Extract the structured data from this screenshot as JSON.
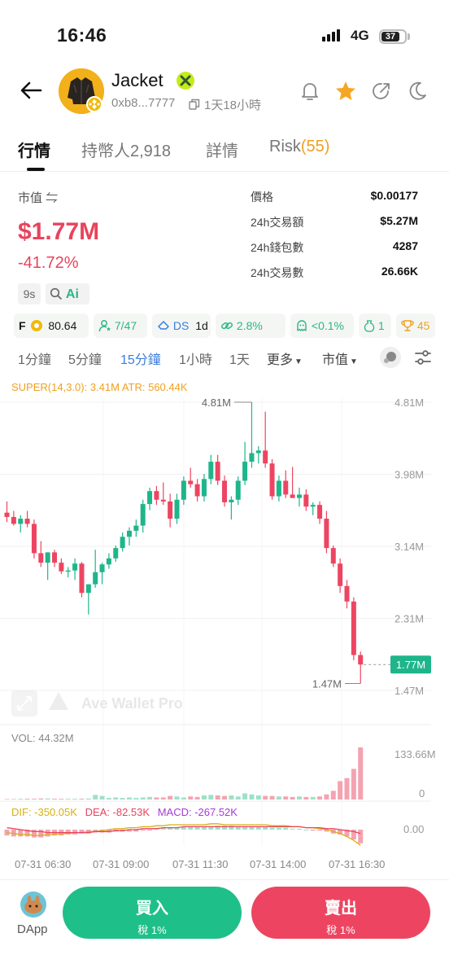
{
  "status_bar": {
    "time": "16:46",
    "network": "4G",
    "battery": "37"
  },
  "header": {
    "token_name": "Jacket",
    "address": "0xb8...7777",
    "age": "1天18小時"
  },
  "tabs": [
    {
      "label": "行情"
    },
    {
      "label": "持幣人2,918"
    },
    {
      "label": "詳情"
    },
    {
      "label": "Risk",
      "count": "(55)"
    }
  ],
  "summary": {
    "market_cap_label": "市值 ⇋",
    "market_cap": "$1.77M",
    "change": "-41.72%",
    "refresh": "9s",
    "ai_label": "Ai"
  },
  "stats": [
    {
      "label": "價格",
      "value": "$0.00177"
    },
    {
      "label": "24h交易額",
      "value": "$5.27M"
    },
    {
      "label": "24h錢包數",
      "value": "4287"
    },
    {
      "label": "24h交易數",
      "value": "26.66K"
    }
  ],
  "badges": {
    "score_prefix": "F",
    "score": "80.64",
    "holders_ratio": "7/47",
    "ds_label": "DS",
    "ds_period": "1d",
    "pct1": "2.8%",
    "pct2": "<0.1%",
    "money": "1",
    "trophy": "45"
  },
  "intervals": {
    "items": [
      "1分鐘",
      "5分鐘",
      "15分鐘",
      "1小時",
      "1天"
    ],
    "more": "更多",
    "metric": "市值"
  },
  "indicators": {
    "super": "SUPER(14,3.0): 3.41M ATR: 560.44K",
    "vol": "VOL: 44.32M",
    "dif": "DIF: -350.05K",
    "dea": "DEA: -82.53K",
    "macd": "MACD: -267.52K",
    "watermark": "Ave Wallet Pro"
  },
  "chart_data": {
    "type": "candlestick",
    "y_axis_labels": [
      "4.81M",
      "3.98M",
      "3.14M",
      "2.31M",
      "1.47M"
    ],
    "ylim": [
      1.47,
      4.81
    ],
    "unit": "M",
    "high_label": "4.81M",
    "low_label": "1.47M",
    "current_label": "1.77M",
    "x_labels": [
      "07-31 06:30",
      "07-31 09:00",
      "07-31 11:30",
      "07-31 14:00",
      "07-31 16:30"
    ],
    "volume_max_label": "133.66M",
    "volume_zero_label": "0",
    "macd_zero_label": "0.00",
    "candles": [
      [
        3.53,
        3.66,
        3.42,
        3.48
      ],
      [
        3.48,
        3.55,
        3.38,
        3.4
      ],
      [
        3.4,
        3.5,
        3.3,
        3.46
      ],
      [
        3.46,
        3.55,
        3.36,
        3.4
      ],
      [
        3.4,
        3.45,
        3.0,
        3.06
      ],
      [
        3.06,
        3.2,
        2.9,
        2.95
      ],
      [
        2.95,
        3.07,
        2.75,
        3.07
      ],
      [
        3.07,
        3.1,
        2.9,
        2.95
      ],
      [
        2.95,
        3.0,
        2.82,
        2.85
      ],
      [
        2.85,
        2.9,
        2.78,
        2.86
      ],
      [
        2.86,
        3.0,
        2.75,
        2.94
      ],
      [
        2.94,
        2.96,
        2.55,
        2.6
      ],
      [
        2.6,
        2.7,
        2.35,
        2.7
      ],
      [
        2.7,
        3.1,
        2.66,
        2.84
      ],
      [
        2.84,
        2.95,
        2.7,
        2.93
      ],
      [
        2.93,
        3.06,
        2.88,
        3.0
      ],
      [
        3.0,
        3.15,
        2.96,
        3.12
      ],
      [
        3.12,
        3.3,
        3.08,
        3.25
      ],
      [
        3.25,
        3.36,
        3.15,
        3.32
      ],
      [
        3.32,
        3.45,
        3.25,
        3.38
      ],
      [
        3.38,
        3.68,
        3.3,
        3.63
      ],
      [
        3.63,
        3.82,
        3.56,
        3.78
      ],
      [
        3.78,
        3.84,
        3.62,
        3.68
      ],
      [
        3.68,
        3.88,
        3.62,
        3.66
      ],
      [
        3.66,
        3.75,
        3.36,
        3.46
      ],
      [
        3.46,
        3.75,
        3.4,
        3.68
      ],
      [
        3.68,
        3.95,
        3.62,
        3.9
      ],
      [
        3.9,
        4.05,
        3.82,
        3.86
      ],
      [
        3.86,
        3.92,
        3.66,
        3.72
      ],
      [
        3.72,
        3.98,
        3.66,
        3.92
      ],
      [
        3.92,
        4.2,
        3.86,
        4.12
      ],
      [
        4.12,
        4.2,
        3.85,
        3.9
      ],
      [
        3.9,
        3.96,
        3.6,
        3.65
      ],
      [
        3.65,
        3.72,
        3.45,
        3.68
      ],
      [
        3.68,
        3.95,
        3.62,
        3.9
      ],
      [
        3.9,
        4.35,
        3.85,
        4.12
      ],
      [
        4.12,
        4.81,
        4.05,
        4.22
      ],
      [
        4.22,
        4.3,
        4.1,
        4.25
      ],
      [
        4.25,
        4.7,
        4.05,
        4.1
      ],
      [
        4.1,
        4.15,
        3.68,
        3.72
      ],
      [
        3.72,
        3.96,
        3.66,
        3.9
      ],
      [
        3.9,
        4.02,
        3.7,
        3.74
      ],
      [
        3.74,
        4.06,
        3.7,
        3.7
      ],
      [
        3.7,
        3.82,
        3.6,
        3.74
      ],
      [
        3.74,
        3.8,
        3.55,
        3.6
      ],
      [
        3.6,
        3.65,
        3.5,
        3.62
      ],
      [
        3.62,
        3.66,
        3.4,
        3.46
      ],
      [
        3.46,
        3.55,
        3.06,
        3.12
      ],
      [
        3.12,
        3.15,
        2.9,
        2.94
      ],
      [
        2.94,
        3.0,
        2.6,
        2.68
      ],
      [
        2.68,
        2.75,
        2.42,
        2.5
      ],
      [
        2.5,
        2.55,
        1.82,
        1.88
      ],
      [
        1.88,
        1.92,
        1.55,
        1.77
      ]
    ],
    "volumes": [
      1,
      1,
      1.5,
      1.5,
      1.5,
      2,
      2,
      1.5,
      1.5,
      1.5,
      1.5,
      1.5,
      2,
      9,
      7,
      3,
      4,
      3,
      4,
      3,
      4,
      5,
      4,
      4,
      7,
      6,
      4,
      6,
      5,
      8,
      9,
      8,
      7,
      8,
      6,
      12,
      10,
      8,
      7,
      7,
      6,
      6,
      5,
      6,
      5,
      5,
      6,
      10,
      17,
      36,
      42,
      60,
      102
    ],
    "macd_hist": [
      -6,
      -7,
      -7,
      -7,
      -8,
      -8,
      -7,
      -6,
      -6,
      -5,
      -5,
      -4,
      -4,
      -3,
      -3,
      -3,
      -2,
      -2,
      -2,
      -2,
      -1,
      -1,
      1,
      2,
      2,
      2,
      3,
      3,
      3,
      3,
      3,
      4,
      4,
      4,
      3,
      3,
      3,
      3,
      3,
      2,
      2,
      2,
      1,
      1,
      0,
      -1,
      -1,
      -2,
      -4,
      -5,
      -7,
      -10,
      -14
    ],
    "dif": [
      -3,
      -4,
      -5,
      -5,
      -6,
      -6,
      -5,
      -5,
      -4,
      -4,
      -3,
      -3,
      -2,
      -2,
      -1,
      0,
      1,
      1,
      2,
      2,
      3,
      3,
      4,
      4,
      5,
      5,
      5,
      5,
      5,
      5,
      6,
      6,
      5,
      5,
      5,
      5,
      5,
      5,
      5,
      4,
      4,
      4,
      3,
      3,
      2,
      2,
      1,
      0,
      -2,
      -4,
      -7,
      -11,
      -16
    ],
    "dea": [
      2,
      1,
      0,
      -1,
      -2,
      -2,
      -3,
      -3,
      -3,
      -3,
      -3,
      -3,
      -3,
      -2,
      -2,
      -2,
      -1,
      -1,
      0,
      0,
      1,
      1,
      1,
      2,
      2,
      2,
      3,
      3,
      3,
      3,
      3,
      3,
      3,
      3,
      3,
      3,
      3,
      3,
      3,
      3,
      3,
      3,
      3,
      3,
      2,
      2,
      2,
      1,
      1,
      0,
      -1,
      -2,
      -4
    ]
  },
  "bottom": {
    "dapp": "DApp",
    "buy": "買入",
    "buy_tax": "稅 1%",
    "sell": "賣出",
    "sell_tax": "稅 1%"
  }
}
